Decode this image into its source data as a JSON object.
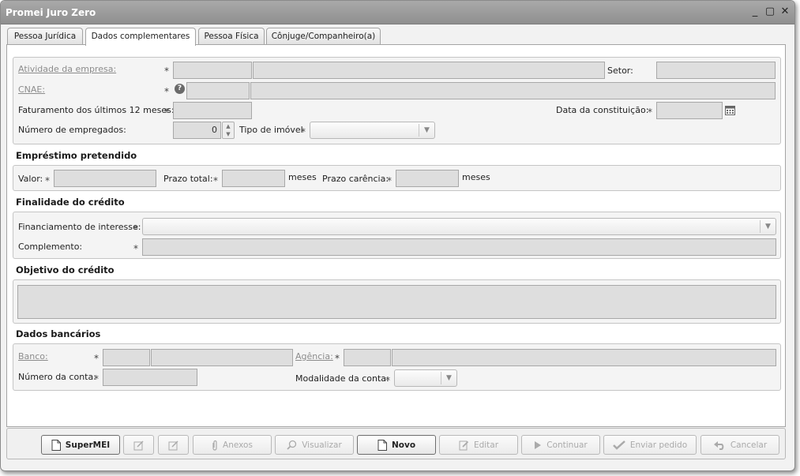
{
  "window": {
    "title": "Promei Juro Zero",
    "minimize": "_",
    "maximize": "▢",
    "close": "✕"
  },
  "tabs": [
    {
      "label": "Pessoa Jurídica",
      "active": false
    },
    {
      "label": "Dados complementares",
      "active": true
    },
    {
      "label": "Pessoa Física",
      "active": false
    },
    {
      "label": "Cônjuge/Companheiro(a)",
      "active": false
    }
  ],
  "company": {
    "atividade_label": "Atividade da empresa:",
    "setor_label": "Setor:",
    "cnae_label": "CNAE:",
    "cnae_help": "?",
    "faturamento_label": "Faturamento dos últimos 12 meses:",
    "data_constituicao_label": "Data da constituição:",
    "empregados_label": "Número de empregados:",
    "empregados_value": "0",
    "tipo_imovel_label": "Tipo de imóvel",
    "required_mark": "*"
  },
  "emprestimo": {
    "title": "Empréstimo pretendido",
    "valor_label": "Valor:",
    "prazo_total_label": "Prazo total:",
    "meses_1": "meses",
    "prazo_carencia_label": "Prazo carência:",
    "meses_2": "meses"
  },
  "finalidade": {
    "title": "Finalidade do crédito",
    "financiamento_label": "Financiamento de interesse:",
    "complemento_label": "Complemento:"
  },
  "objetivo": {
    "title": "Objetivo do crédito"
  },
  "bancarios": {
    "title": "Dados bancários",
    "banco_label": "Banco:",
    "agencia_label": "Agência:",
    "conta_label": "Número da conta:",
    "modalidade_label": "Modalidade da conta:"
  },
  "buttons": {
    "supermei": "SuperMEI",
    "anexos": "Anexos",
    "visualizar": "Visualizar",
    "novo": "Novo",
    "editar": "Editar",
    "continuar": "Continuar",
    "enviar": "Enviar pedido",
    "cancelar": "Cancelar"
  }
}
